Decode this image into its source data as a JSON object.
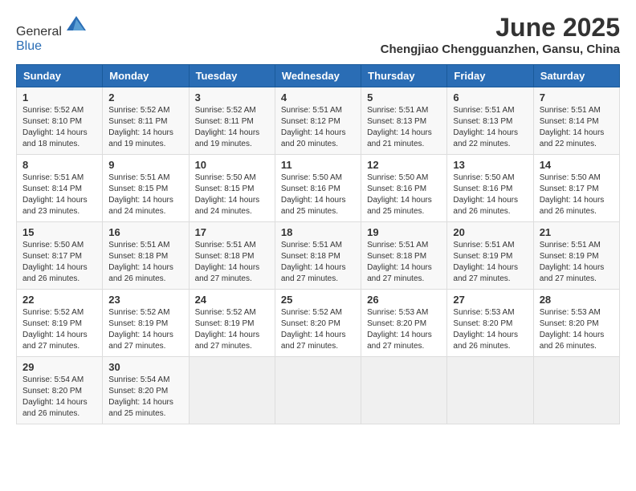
{
  "logo": {
    "line1": "General",
    "line2": "Blue"
  },
  "title": "June 2025",
  "subtitle": "Chengjiao Chengguanzhen, Gansu, China",
  "headers": [
    "Sunday",
    "Monday",
    "Tuesday",
    "Wednesday",
    "Thursday",
    "Friday",
    "Saturday"
  ],
  "weeks": [
    [
      {
        "day": "1",
        "lines": [
          "Sunrise: 5:52 AM",
          "Sunset: 8:10 PM",
          "Daylight: 14 hours",
          "and 18 minutes."
        ]
      },
      {
        "day": "2",
        "lines": [
          "Sunrise: 5:52 AM",
          "Sunset: 8:11 PM",
          "Daylight: 14 hours",
          "and 19 minutes."
        ]
      },
      {
        "day": "3",
        "lines": [
          "Sunrise: 5:52 AM",
          "Sunset: 8:11 PM",
          "Daylight: 14 hours",
          "and 19 minutes."
        ]
      },
      {
        "day": "4",
        "lines": [
          "Sunrise: 5:51 AM",
          "Sunset: 8:12 PM",
          "Daylight: 14 hours",
          "and 20 minutes."
        ]
      },
      {
        "day": "5",
        "lines": [
          "Sunrise: 5:51 AM",
          "Sunset: 8:13 PM",
          "Daylight: 14 hours",
          "and 21 minutes."
        ]
      },
      {
        "day": "6",
        "lines": [
          "Sunrise: 5:51 AM",
          "Sunset: 8:13 PM",
          "Daylight: 14 hours",
          "and 22 minutes."
        ]
      },
      {
        "day": "7",
        "lines": [
          "Sunrise: 5:51 AM",
          "Sunset: 8:14 PM",
          "Daylight: 14 hours",
          "and 22 minutes."
        ]
      }
    ],
    [
      {
        "day": "8",
        "lines": [
          "Sunrise: 5:51 AM",
          "Sunset: 8:14 PM",
          "Daylight: 14 hours",
          "and 23 minutes."
        ]
      },
      {
        "day": "9",
        "lines": [
          "Sunrise: 5:51 AM",
          "Sunset: 8:15 PM",
          "Daylight: 14 hours",
          "and 24 minutes."
        ]
      },
      {
        "day": "10",
        "lines": [
          "Sunrise: 5:50 AM",
          "Sunset: 8:15 PM",
          "Daylight: 14 hours",
          "and 24 minutes."
        ]
      },
      {
        "day": "11",
        "lines": [
          "Sunrise: 5:50 AM",
          "Sunset: 8:16 PM",
          "Daylight: 14 hours",
          "and 25 minutes."
        ]
      },
      {
        "day": "12",
        "lines": [
          "Sunrise: 5:50 AM",
          "Sunset: 8:16 PM",
          "Daylight: 14 hours",
          "and 25 minutes."
        ]
      },
      {
        "day": "13",
        "lines": [
          "Sunrise: 5:50 AM",
          "Sunset: 8:16 PM",
          "Daylight: 14 hours",
          "and 26 minutes."
        ]
      },
      {
        "day": "14",
        "lines": [
          "Sunrise: 5:50 AM",
          "Sunset: 8:17 PM",
          "Daylight: 14 hours",
          "and 26 minutes."
        ]
      }
    ],
    [
      {
        "day": "15",
        "lines": [
          "Sunrise: 5:50 AM",
          "Sunset: 8:17 PM",
          "Daylight: 14 hours",
          "and 26 minutes."
        ]
      },
      {
        "day": "16",
        "lines": [
          "Sunrise: 5:51 AM",
          "Sunset: 8:18 PM",
          "Daylight: 14 hours",
          "and 26 minutes."
        ]
      },
      {
        "day": "17",
        "lines": [
          "Sunrise: 5:51 AM",
          "Sunset: 8:18 PM",
          "Daylight: 14 hours",
          "and 27 minutes."
        ]
      },
      {
        "day": "18",
        "lines": [
          "Sunrise: 5:51 AM",
          "Sunset: 8:18 PM",
          "Daylight: 14 hours",
          "and 27 minutes."
        ]
      },
      {
        "day": "19",
        "lines": [
          "Sunrise: 5:51 AM",
          "Sunset: 8:18 PM",
          "Daylight: 14 hours",
          "and 27 minutes."
        ]
      },
      {
        "day": "20",
        "lines": [
          "Sunrise: 5:51 AM",
          "Sunset: 8:19 PM",
          "Daylight: 14 hours",
          "and 27 minutes."
        ]
      },
      {
        "day": "21",
        "lines": [
          "Sunrise: 5:51 AM",
          "Sunset: 8:19 PM",
          "Daylight: 14 hours",
          "and 27 minutes."
        ]
      }
    ],
    [
      {
        "day": "22",
        "lines": [
          "Sunrise: 5:52 AM",
          "Sunset: 8:19 PM",
          "Daylight: 14 hours",
          "and 27 minutes."
        ]
      },
      {
        "day": "23",
        "lines": [
          "Sunrise: 5:52 AM",
          "Sunset: 8:19 PM",
          "Daylight: 14 hours",
          "and 27 minutes."
        ]
      },
      {
        "day": "24",
        "lines": [
          "Sunrise: 5:52 AM",
          "Sunset: 8:19 PM",
          "Daylight: 14 hours",
          "and 27 minutes."
        ]
      },
      {
        "day": "25",
        "lines": [
          "Sunrise: 5:52 AM",
          "Sunset: 8:20 PM",
          "Daylight: 14 hours",
          "and 27 minutes."
        ]
      },
      {
        "day": "26",
        "lines": [
          "Sunrise: 5:53 AM",
          "Sunset: 8:20 PM",
          "Daylight: 14 hours",
          "and 27 minutes."
        ]
      },
      {
        "day": "27",
        "lines": [
          "Sunrise: 5:53 AM",
          "Sunset: 8:20 PM",
          "Daylight: 14 hours",
          "and 26 minutes."
        ]
      },
      {
        "day": "28",
        "lines": [
          "Sunrise: 5:53 AM",
          "Sunset: 8:20 PM",
          "Daylight: 14 hours",
          "and 26 minutes."
        ]
      }
    ],
    [
      {
        "day": "29",
        "lines": [
          "Sunrise: 5:54 AM",
          "Sunset: 8:20 PM",
          "Daylight: 14 hours",
          "and 26 minutes."
        ]
      },
      {
        "day": "30",
        "lines": [
          "Sunrise: 5:54 AM",
          "Sunset: 8:20 PM",
          "Daylight: 14 hours",
          "and 25 minutes."
        ]
      },
      {
        "day": "",
        "lines": []
      },
      {
        "day": "",
        "lines": []
      },
      {
        "day": "",
        "lines": []
      },
      {
        "day": "",
        "lines": []
      },
      {
        "day": "",
        "lines": []
      }
    ]
  ]
}
